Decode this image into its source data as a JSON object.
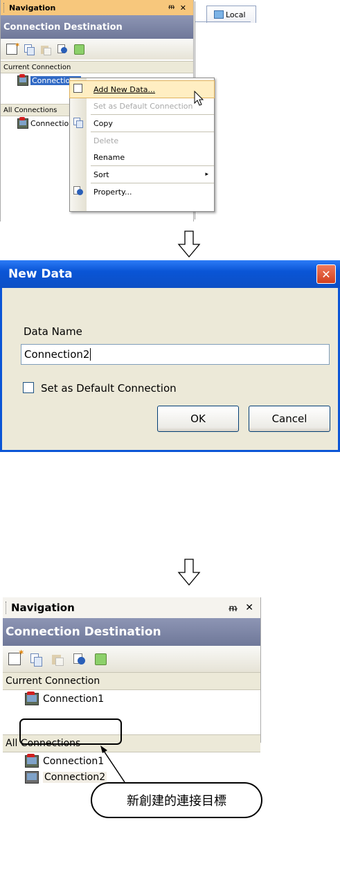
{
  "top_panel": {
    "title": "Navigation",
    "pin_glyph": "P",
    "close_glyph": "✕",
    "header": "Connection Destination",
    "toolbar_icons": [
      "new-data-icon",
      "copy-icon",
      "paste-icon",
      "property-icon",
      "refresh-icon"
    ],
    "current_section": "Current Connection",
    "current_item": "Connection1",
    "all_section": "All Connections",
    "all_item": "Connectio"
  },
  "doc_tab": {
    "label": "Local"
  },
  "context_menu": {
    "items": [
      {
        "label": "Add New Data...",
        "state": "highlighted",
        "icon": "add-new-data-icon"
      },
      {
        "label": "Set as Default Connection",
        "state": "disabled"
      },
      {
        "label": "Copy",
        "state": "enabled",
        "icon": "copy-icon"
      },
      {
        "label": "Delete",
        "state": "disabled"
      },
      {
        "label": "Rename",
        "state": "enabled"
      },
      {
        "label": "Sort",
        "state": "enabled",
        "submenu": "▸"
      },
      {
        "label": "Property...",
        "state": "enabled",
        "icon": "property-icon"
      }
    ]
  },
  "dialog": {
    "title": "New Data",
    "close_glyph": "✕",
    "field_label": "Data Name",
    "field_value": "Connection2",
    "checkbox_label": "Set as Default Connection",
    "checkbox_checked": false,
    "ok_label": "OK",
    "cancel_label": "Cancel"
  },
  "bottom_panel": {
    "title": "Navigation",
    "pin_glyph": "P",
    "close_glyph": "✕",
    "header": "Connection Destination",
    "current_section": "Current Connection",
    "current_items": [
      "Connection1"
    ],
    "all_section": "All Connections",
    "all_items": [
      "Connection1",
      "Connection2"
    ]
  },
  "callout": {
    "text": "新創建的連接目標"
  },
  "colors": {
    "highlight": "#ffeec2",
    "dialog_title": "#0a55d6",
    "header": "#7a83a4"
  }
}
